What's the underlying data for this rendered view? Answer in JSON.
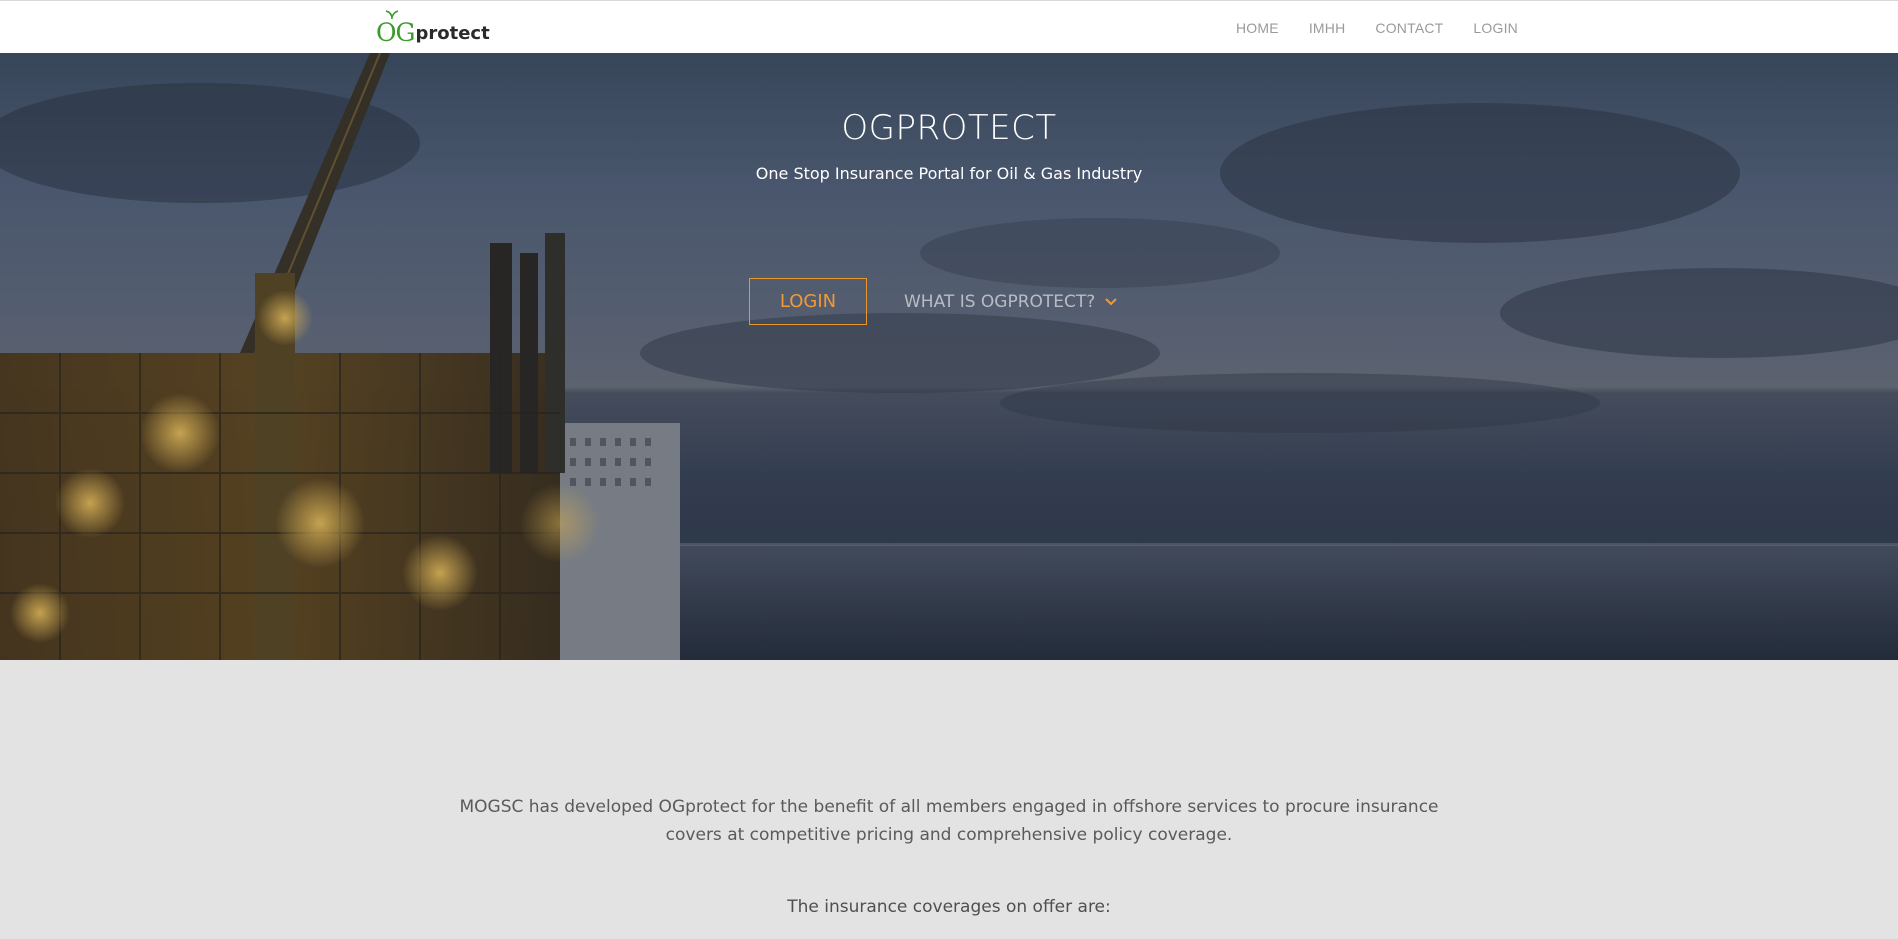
{
  "navbar": {
    "logo": {
      "og": "OG",
      "protect": "protect"
    },
    "links": [
      {
        "label": "HOME"
      },
      {
        "label": "IMHH"
      },
      {
        "label": "CONTACT"
      },
      {
        "label": "LOGIN"
      }
    ]
  },
  "hero": {
    "title": "OGPROTECT",
    "subtitle": "One Stop Insurance Portal for Oil & Gas Industry",
    "login_button": "LOGIN",
    "what_button": "WHAT IS OGPROTECT?",
    "chevron_icon": "chevron-down-icon",
    "accent_color": "#f09a35"
  },
  "content": {
    "intro": "MOGSC has developed OGprotect for the benefit of all members engaged in offshore services to procure insurance covers at competitive pricing and comprehensive policy coverage.",
    "coverages_heading": "The insurance coverages on offer are:"
  },
  "colors": {
    "logo_green": "#3b9b2c",
    "nav_text": "#9a9a9a",
    "page_bg": "#e3e3e3"
  }
}
